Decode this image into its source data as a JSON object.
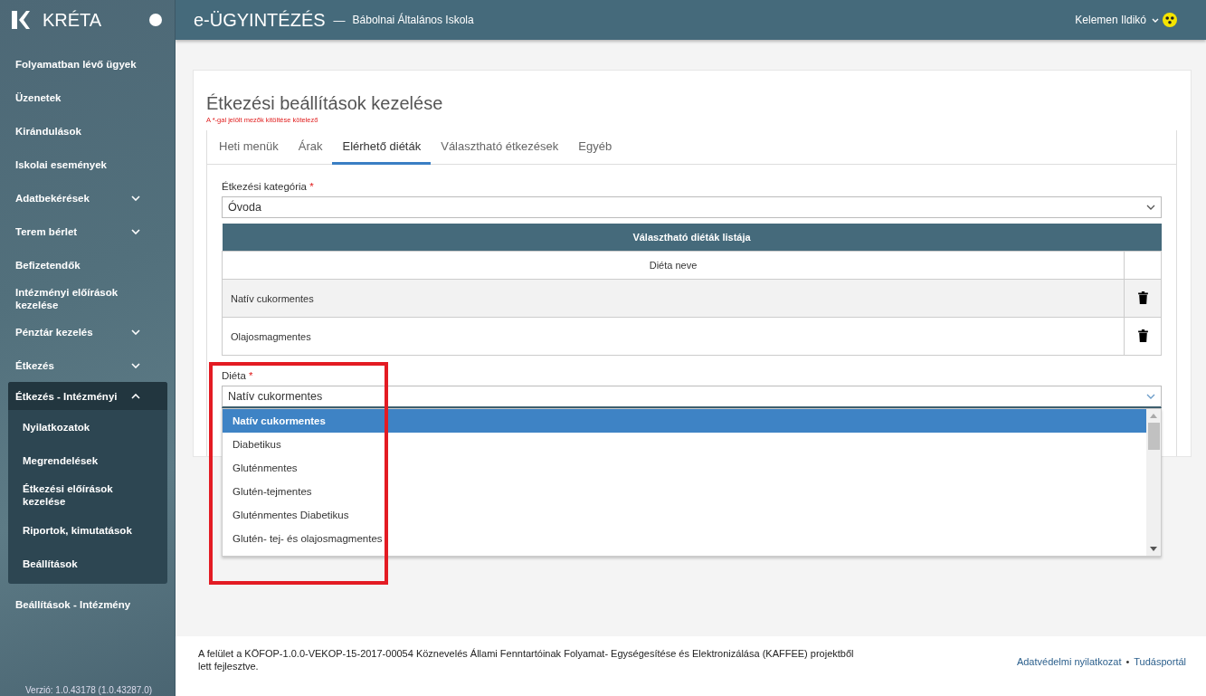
{
  "brand": {
    "name": "KRÉTA"
  },
  "sidebar": {
    "items": [
      {
        "label": "Folyamatban lévő ügyek",
        "kind": "link"
      },
      {
        "label": "Üzenetek",
        "kind": "link"
      },
      {
        "label": "Kirándulások",
        "kind": "link"
      },
      {
        "label": "Iskolai események",
        "kind": "link"
      },
      {
        "label": "Adatbekérések",
        "kind": "group",
        "expanded": false
      },
      {
        "label": "Terem bérlet",
        "kind": "group",
        "expanded": false
      },
      {
        "label": "Befizetendők",
        "kind": "link"
      },
      {
        "label": "Intézményi előírások kezelése",
        "kind": "link"
      },
      {
        "label": "Pénztár kezelés",
        "kind": "group",
        "expanded": false
      },
      {
        "label": "Étkezés",
        "kind": "group",
        "expanded": false
      },
      {
        "label": "Étkezés - Intézményi",
        "kind": "group",
        "expanded": true,
        "children": [
          {
            "label": "Nyilatkozatok"
          },
          {
            "label": "Megrendelések"
          },
          {
            "label": "Étkezési előírások kezelése"
          },
          {
            "label": "Riportok, kimutatások"
          },
          {
            "label": "Beállítások"
          }
        ]
      },
      {
        "label": "Beállítások - Intézmény",
        "kind": "link"
      }
    ],
    "version": "Verzió: 1.0.43178 (1.0.43287.0)"
  },
  "header": {
    "title": "e-ÜGYINTÉZÉS",
    "separator": "—",
    "school": "Bábolnai Általános Iskola",
    "user": "Kelemen Ildikó"
  },
  "page": {
    "title": "Étkezési beállítások kezelése",
    "required_note": "A *-gal jelölt mezők kitöltése kötelező",
    "tabs": [
      {
        "label": "Heti menük",
        "selected": false
      },
      {
        "label": "Árak",
        "selected": false
      },
      {
        "label": "Elérhető diéták",
        "selected": true
      },
      {
        "label": "Választható étkezések",
        "selected": false
      },
      {
        "label": "Egyéb",
        "selected": false
      }
    ],
    "category": {
      "label": "Étkezési kategória",
      "required_mark": "*",
      "value": "Óvoda"
    },
    "table": {
      "title": "Választható diéták listája",
      "columns": [
        "Diéta neve"
      ],
      "rows": [
        {
          "name": "Natív cukormentes"
        },
        {
          "name": "Olajosmagmentes"
        }
      ]
    },
    "diet": {
      "label": "Diéta",
      "required_mark": "*",
      "value": "Natív cukormentes",
      "options": [
        {
          "label": "Natív cukormentes",
          "selected": true
        },
        {
          "label": "Diabetikus",
          "selected": false
        },
        {
          "label": "Gluténmentes",
          "selected": false
        },
        {
          "label": "Glutén-tejmentes",
          "selected": false
        },
        {
          "label": "Gluténmentes Diabetikus",
          "selected": false
        },
        {
          "label": "Glutén- tej- és olajosmagmentes",
          "selected": false
        }
      ]
    }
  },
  "footer": {
    "note": "A felület a KÖFOP-1.0.0-VEKOP-15-2017-00054 Köznevelés Állami Fenntartóinak Folyamat- Egységesítése és Elektronizálása (KAFFEE) projektből lett fejlesztve.",
    "links": [
      "Adatvédelmi nyilatkozat",
      "Tudásportál"
    ],
    "link_separator": "•"
  }
}
